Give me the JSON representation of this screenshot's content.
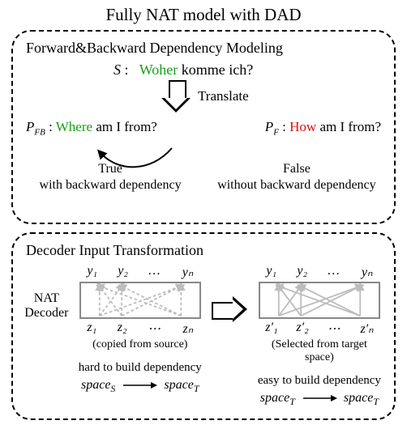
{
  "title": "Fully NAT model with DAD",
  "top": {
    "heading": "Forward&Backward Dependency Modeling",
    "source_label": "S",
    "source_hi": "Woher",
    "source_rest": " komme ich?",
    "translate_label": "Translate",
    "pfb_label": "P",
    "pfb_sub": "FB",
    "pfb_hi": "Where",
    "pfb_rest": " am I from?",
    "pf_label": "P",
    "pf_sub": "F",
    "pf_hi": "How",
    "pf_rest": " am I from?",
    "true_label": "True",
    "true_desc": "with backward dependency",
    "false_label": "False",
    "false_desc": "without backward dependency"
  },
  "bottom": {
    "heading": "Decoder Input Transformation",
    "nat_label_1": "NAT",
    "nat_label_2": "Decoder",
    "y_syms": [
      "y₁",
      "y₂",
      "…",
      "yₙ"
    ],
    "z_left": [
      "z₁",
      "z₂",
      "⋯",
      "zₙ"
    ],
    "z_right": [
      "z′₁",
      "z′₂",
      "⋯",
      "z′ₙ"
    ],
    "left_caption1": "(copied from source)",
    "right_caption1": "(Selected from target space)",
    "left_caption2": "hard to build dependency",
    "right_caption2": "easy to build dependency",
    "space_s": "spaceS",
    "space_t": "spaceT"
  }
}
